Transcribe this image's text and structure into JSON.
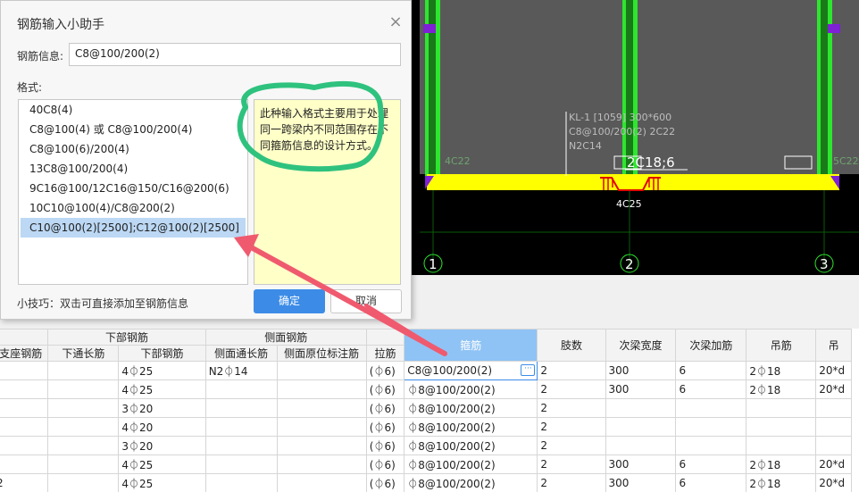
{
  "dialog": {
    "title": "钢筋输入小助手",
    "close_icon": "×",
    "info_label": "钢筋信息:",
    "info_value": "C8@100/200(2)",
    "format_label": "格式:",
    "formats": [
      "40C8(4)",
      "C8@100(4) 或 C8@100/200(4)",
      "C8@100(6)/200(4)",
      "13C8@100/200(4)",
      "9C16@100/12C16@150/C16@200(6)",
      "10C10@100(4)/C8@200(2)",
      "C10@100(2)[2500];C12@100(2)[2500]"
    ],
    "selected_index": 6,
    "note": "此种输入格式主要用于处理同一跨梁内不同范围存在不同箍筋信息的设计方式。",
    "tip": "小技巧：双击可直接添加至钢筋信息",
    "ok_label": "确定",
    "cancel_label": "取消"
  },
  "cad": {
    "beam_label_1": "KL-1 [1059] 300*600",
    "beam_label_2": "C8@100/200(2) 2C22",
    "beam_label_3": "N2C14",
    "left_support": "4C22",
    "right_support": "5C22",
    "top_bar": "2C18;6",
    "bottom_bar": "4C25",
    "axis_1": "1",
    "axis_2": "2",
    "axis_3": "3"
  },
  "table": {
    "group_headers": {
      "bottom": "下部钢筋",
      "side": "侧面钢筋"
    },
    "headers": [
      "支座钢筋",
      "下通长筋",
      "下部钢筋",
      "侧面通长筋",
      "侧面原位标注筋",
      "拉筋",
      "箍筋",
      "肢数",
      "次梁宽度",
      "次梁加筋",
      "吊筋",
      "吊"
    ],
    "rows": [
      [
        "",
        "",
        "4⏀25",
        "N2⏀14",
        "",
        "(⏀6)",
        "C8@100/200(2)",
        "2",
        "300",
        "6",
        "2⏀18",
        "20*d"
      ],
      [
        "",
        "",
        "4⏀25",
        "",
        "",
        "(⏀6)",
        "⏀8@100/200(2)",
        "2",
        "300",
        "6",
        "2⏀18",
        "20*d"
      ],
      [
        "",
        "",
        "3⏀20",
        "",
        "",
        "(⏀6)",
        "⏀8@100/200(2)",
        "2",
        "",
        "",
        "",
        ""
      ],
      [
        "",
        "",
        "4⏀20",
        "",
        "",
        "(⏀6)",
        "⏀8@100/200(2)",
        "2",
        "",
        "",
        "",
        ""
      ],
      [
        "",
        "",
        "3⏀20",
        "",
        "",
        "(⏀6)",
        "⏀8@100/200(2)",
        "2",
        "",
        "",
        "",
        ""
      ],
      [
        "",
        "",
        "4⏀25",
        "",
        "",
        "(⏀6)",
        "⏀8@100/200(2)",
        "2",
        "300",
        "6",
        "2⏀18",
        "20*d"
      ],
      [
        "2",
        "",
        "4⏀25",
        "",
        "",
        "(⏀6)",
        "⏀8@100/200(2)",
        "2",
        "300",
        "6",
        "2⏀18",
        "20*d"
      ]
    ],
    "more_icon": "···",
    "colors": {
      "selected_header": "#8fc3f5",
      "edit_border": "#3c8ce7"
    }
  },
  "colors": {
    "cad_background": "#000000",
    "column": "#2ee62e",
    "beam": "#ffff00",
    "marker": "#7f1fd6",
    "annotation": "#2ec27e",
    "arrow": "#f05a6e",
    "rebar_red": "#e00000"
  }
}
